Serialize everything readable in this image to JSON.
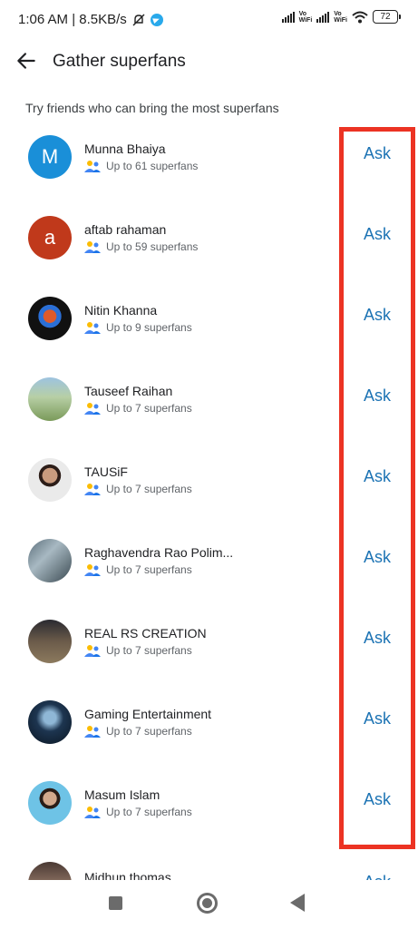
{
  "status": {
    "time_speed": "1:06 AM | 8.5KB/s",
    "vowifi1": "Vo\nWiFi",
    "vowifi2": "Vo\nWiFi",
    "battery": "72"
  },
  "header": {
    "title": "Gather superfans"
  },
  "subtitle": "Try friends who can bring the most superfans",
  "friends": [
    {
      "name": "Munna Bhaiya",
      "fans": "Up to 61 superfans",
      "ask": "Ask",
      "initial": "M",
      "color": "#1a8fd8"
    },
    {
      "name": "aftab rahaman",
      "fans": "Up to 59 superfans",
      "ask": "Ask",
      "initial": "a",
      "color": "#c0391b"
    },
    {
      "name": "Nitin Khanna",
      "fans": "Up to 9 superfans",
      "ask": "Ask"
    },
    {
      "name": "Tauseef Raihan",
      "fans": "Up to 7 superfans",
      "ask": "Ask"
    },
    {
      "name": "TAUSiF",
      "fans": "Up to 7 superfans",
      "ask": "Ask"
    },
    {
      "name": "Raghavendra Rao Polim...",
      "fans": "Up to 7 superfans",
      "ask": "Ask"
    },
    {
      "name": "REAL RS CREATION",
      "fans": "Up to 7 superfans",
      "ask": "Ask"
    },
    {
      "name": "Gaming Entertainment",
      "fans": "Up to 7 superfans",
      "ask": "Ask"
    },
    {
      "name": "Masum Islam",
      "fans": "Up to 7 superfans",
      "ask": "Ask"
    }
  ],
  "partial_row": {
    "name": "Midhun thomas",
    "ask": "Ask"
  },
  "nav": {
    "recents": "square-icon",
    "home": "circle-icon",
    "back": "triangle-back-icon"
  }
}
